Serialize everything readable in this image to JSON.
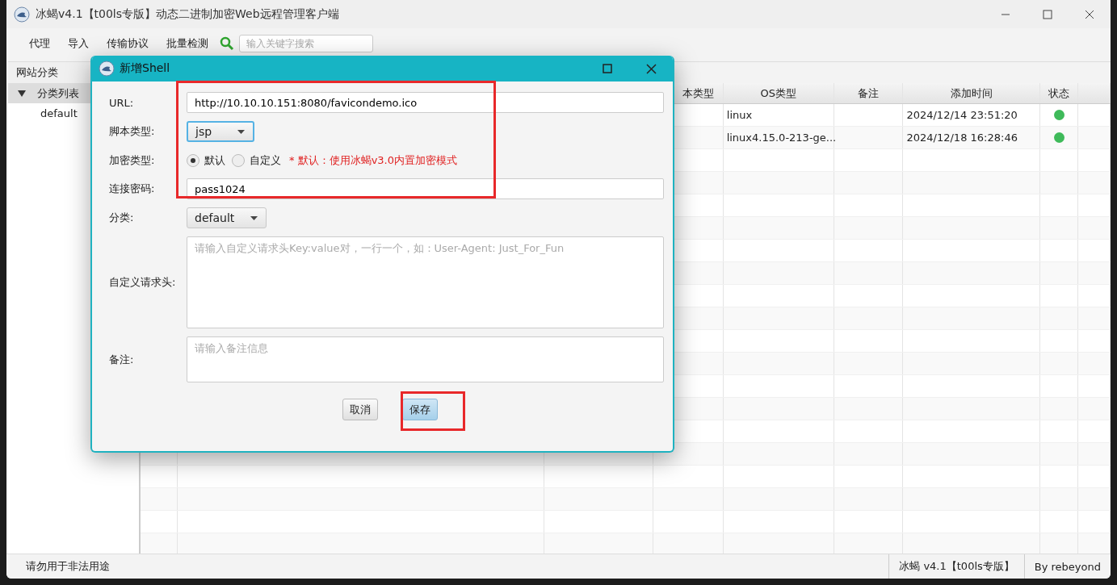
{
  "window": {
    "title": "冰蝎v4.1【t00ls专版】动态二进制加密Web远程管理客户端"
  },
  "menu": [
    "代理",
    "导入",
    "传输协议",
    "批量检测"
  ],
  "search": {
    "placeholder": "输入关键字搜索"
  },
  "sidebar": {
    "title": "网站分类",
    "tree": {
      "label": "分类列表",
      "expanded": true,
      "children": [
        {
          "label": "default"
        }
      ]
    }
  },
  "table": {
    "columns": [
      "本类型",
      "OS类型",
      "备注",
      "添加时间",
      "状态"
    ],
    "rows": [
      {
        "cells": [
          "",
          "linux",
          "",
          "2024/12/14 23:51:20"
        ],
        "online": true
      },
      {
        "cells": [
          "",
          "linux4.15.0-213-ge...",
          "",
          "2024/12/18 16:28:46"
        ],
        "online": true
      }
    ]
  },
  "dialog": {
    "title": "新增Shell",
    "fields": [
      {
        "kind": "text",
        "label": "URL:",
        "value": "http://10.10.10.151:8080/favicondemo.ico"
      },
      {
        "kind": "select",
        "label": "脚本类型:",
        "value": "jsp",
        "focused": true
      },
      {
        "kind": "radio",
        "label": "加密类型:",
        "options": [
          {
            "label": "默认",
            "selected": true
          },
          {
            "label": "自定义",
            "selected": false
          }
        ],
        "note": "* 默认：使用冰蝎v3.0内置加密模式"
      },
      {
        "kind": "text",
        "label": "连接密码:",
        "value": "pass1024"
      },
      {
        "kind": "select",
        "label": "分类:",
        "value": "default",
        "focused": false
      },
      {
        "kind": "textarea",
        "label": "自定义请求头:",
        "placeholder": "请输入自定义请求头Key:value对，一行一个，如：User-Agent: Just_For_Fun"
      },
      {
        "kind": "memo",
        "label": "备注:",
        "placeholder": "请输入备注信息"
      }
    ],
    "buttons": [
      {
        "label": "取消",
        "primary": false
      },
      {
        "label": "保存",
        "primary": true
      }
    ]
  },
  "status_bar": {
    "left": "请勿用于非法用途",
    "version": "冰蝎 v4.1【t00ls专版】",
    "author": "By rebeyond"
  }
}
